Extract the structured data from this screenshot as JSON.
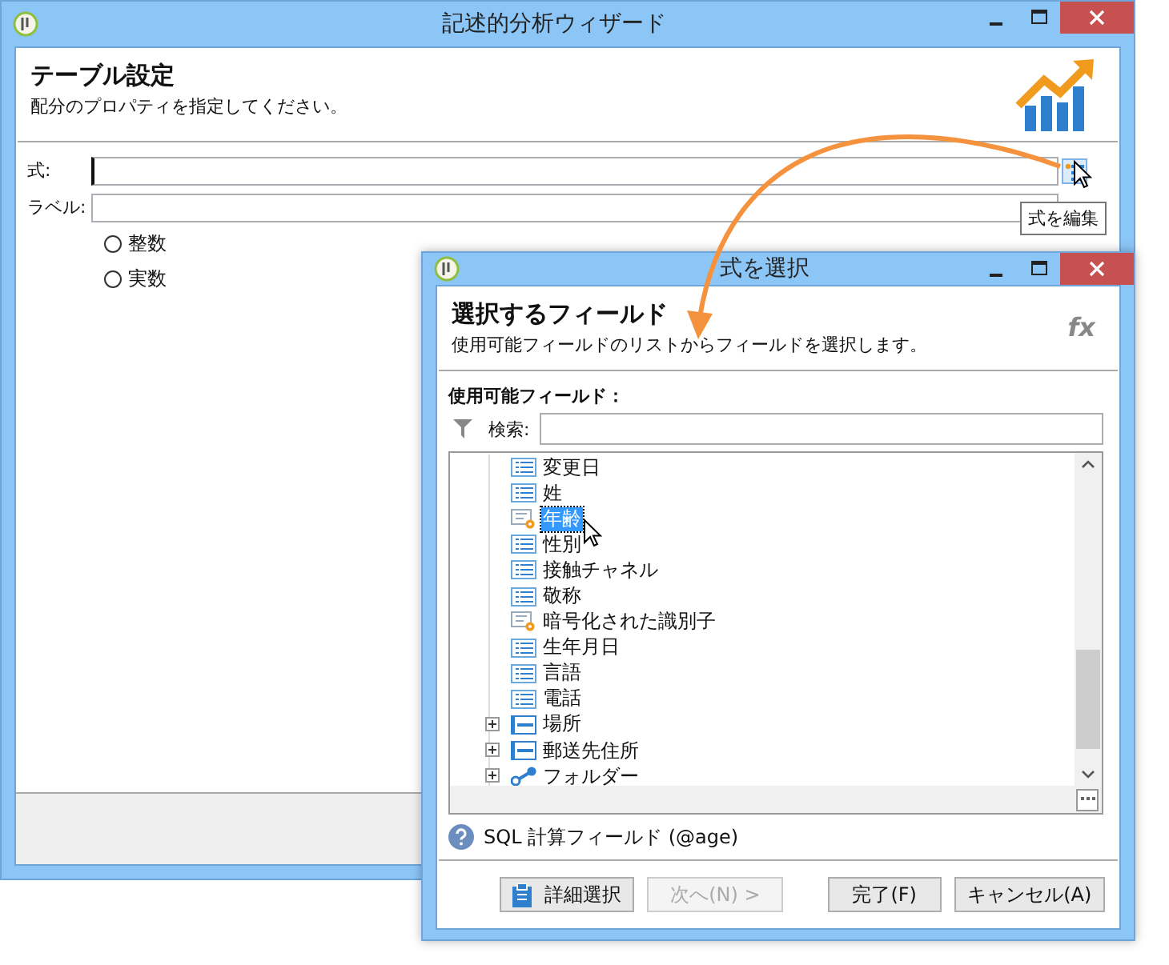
{
  "main_window": {
    "title": "記述的分析ウィザード",
    "heading": "テーブル設定",
    "subtitle": "配分のプロパティを指定してください。",
    "fields": [
      {
        "label": "式:"
      },
      {
        "label": "ラベル:"
      }
    ],
    "radios": [
      {
        "label": "整数",
        "selected": false
      },
      {
        "label": "実数",
        "selected": false
      }
    ],
    "tooltip": "式を編集"
  },
  "dialog": {
    "title": "式を選択",
    "heading": "選択するフィールド",
    "subtitle": "使用可能フィールドのリストからフィールドを選択します。",
    "formula_mark": "fx",
    "list_label": "使用可能フィールド：",
    "search_label": "検索:",
    "tree": [
      {
        "label": "変更日",
        "kind": "field",
        "selected": false
      },
      {
        "label": "姓",
        "kind": "field",
        "selected": false
      },
      {
        "label": "年齢",
        "kind": "computed",
        "selected": true
      },
      {
        "label": "性別",
        "kind": "field",
        "selected": false
      },
      {
        "label": "接触チャネル",
        "kind": "field",
        "selected": false
      },
      {
        "label": "敬称",
        "kind": "field",
        "selected": false
      },
      {
        "label": "暗号化された識別子",
        "kind": "computed",
        "selected": false
      },
      {
        "label": "生年月日",
        "kind": "field",
        "selected": false
      },
      {
        "label": "言語",
        "kind": "field",
        "selected": false
      },
      {
        "label": "電話",
        "kind": "field",
        "selected": false
      },
      {
        "label": "場所",
        "kind": "group",
        "selected": false
      },
      {
        "label": "郵送先住所",
        "kind": "group",
        "selected": false
      },
      {
        "label": "フォルダー",
        "kind": "link",
        "selected": false
      }
    ],
    "help": "SQL 計算フィールド (@age)",
    "buttons": [
      {
        "label": "詳細選択",
        "kind": "icon",
        "disabled": false
      },
      {
        "label": "次へ(N) >",
        "kind": "plain",
        "disabled": true
      },
      {
        "label": "完了(F)",
        "kind": "plain",
        "disabled": false
      },
      {
        "label": "キャンセル(A)",
        "kind": "plain",
        "disabled": false
      }
    ]
  }
}
